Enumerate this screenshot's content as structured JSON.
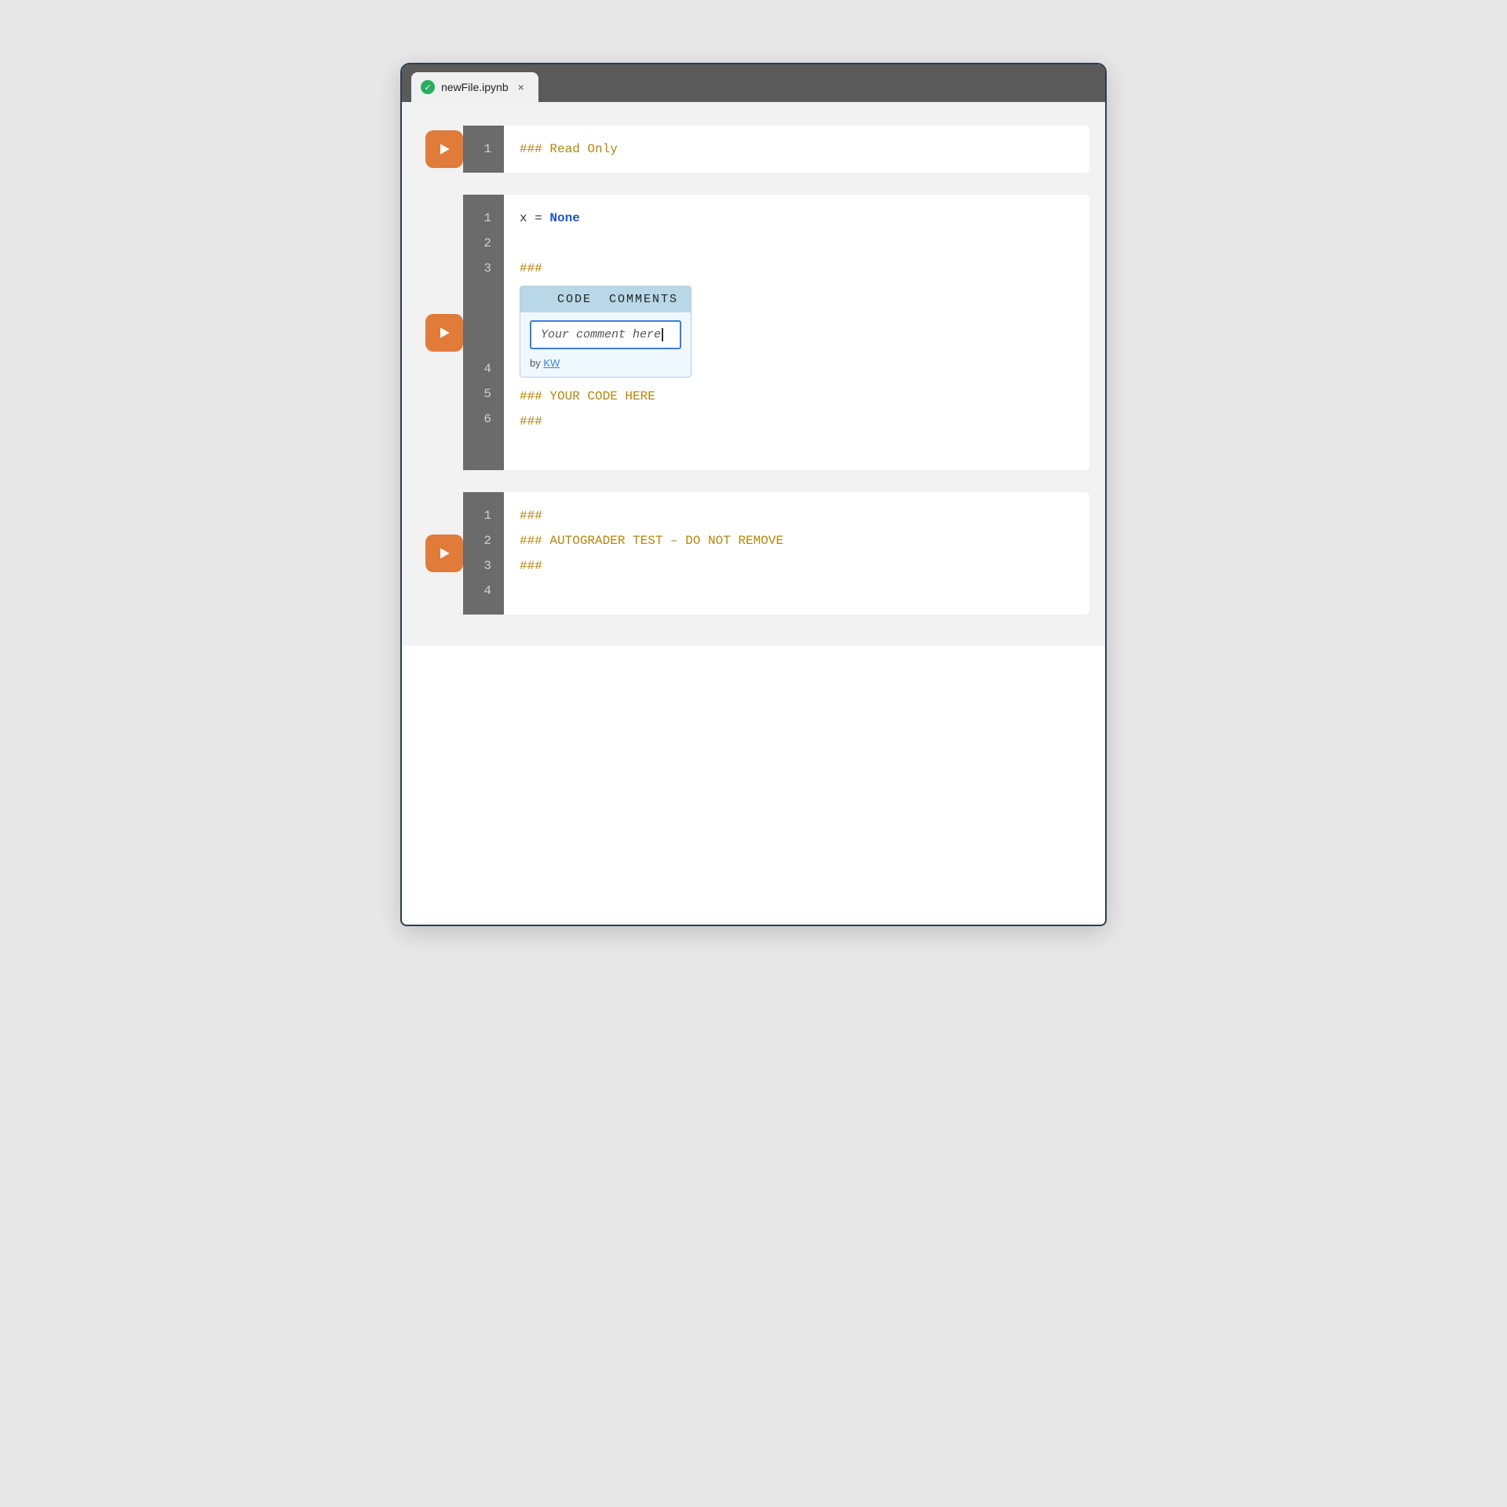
{
  "window": {
    "tab_filename": "newFile.ipynb",
    "tab_close": "×"
  },
  "cells": [
    {
      "id": "cell1",
      "has_run_button": true,
      "lines": [
        {
          "num": "1",
          "text": "### Read Only",
          "color": "comment"
        }
      ]
    },
    {
      "id": "cell2",
      "has_run_button": true,
      "lines": [
        {
          "num": "1",
          "text": "x = None",
          "color": "default_keyword"
        },
        {
          "num": "2",
          "text": "",
          "color": "default"
        },
        {
          "num": "3",
          "text": "###",
          "color": "comment"
        }
      ],
      "comment_box": {
        "header": "CODE  COMMENTS",
        "input_placeholder": "Your comment here",
        "input_value": "Your comment here",
        "by_label": "by",
        "by_user": "KW"
      },
      "lines_after": [
        {
          "num": "4",
          "text": "### YOUR CODE HERE",
          "color": "comment"
        },
        {
          "num": "5",
          "text": "###",
          "color": "comment"
        },
        {
          "num": "6",
          "text": "",
          "color": "default"
        }
      ]
    },
    {
      "id": "cell3",
      "has_run_button": true,
      "lines": [
        {
          "num": "1",
          "text": "###",
          "color": "comment"
        },
        {
          "num": "2",
          "text": "### AUTOGRADER TEST – DO NOT REMOVE",
          "color": "comment"
        },
        {
          "num": "3",
          "text": "###",
          "color": "comment"
        },
        {
          "num": "4",
          "text": "",
          "color": "default"
        }
      ]
    }
  ],
  "icons": {
    "play": "▶",
    "check": "✓"
  }
}
